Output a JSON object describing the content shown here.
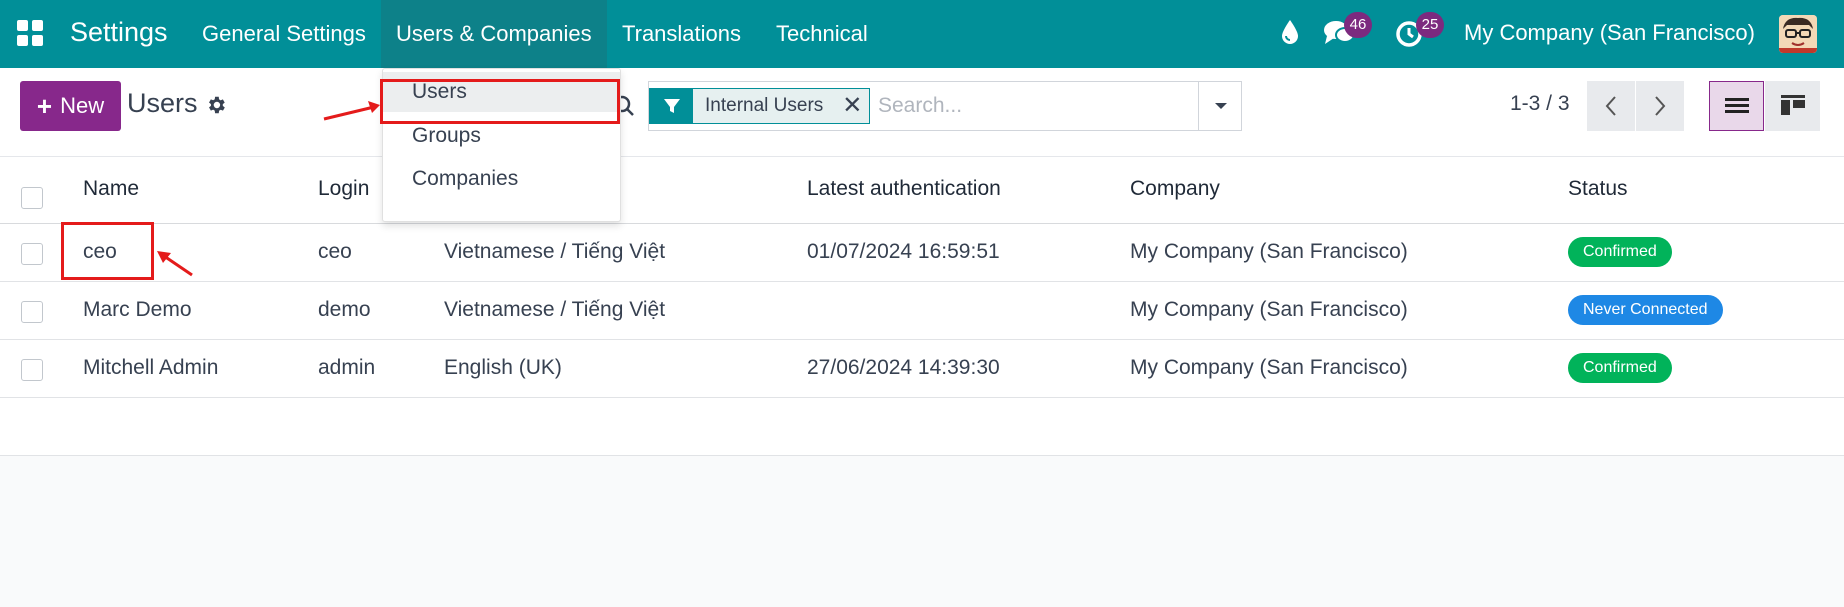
{
  "navbar": {
    "brand": "Settings",
    "menus": [
      "General Settings",
      "Users & Companies",
      "Translations",
      "Technical"
    ],
    "messages_badge": "46",
    "activities_badge": "25",
    "company": "My Company (San Francisco)",
    "color": "#018f98"
  },
  "control": {
    "new_label": "New",
    "title": "Users",
    "facet_label": "Internal Users",
    "search_placeholder": "Search...",
    "pager": "1-3 / 3"
  },
  "dropdown": {
    "items": [
      "Users",
      "Groups",
      "Companies"
    ]
  },
  "table": {
    "headers": [
      "Name",
      "Login",
      "Latest authentication",
      "Company",
      "Status"
    ],
    "rows": [
      {
        "name": "ceo",
        "login": "ceo",
        "language": "Vietnamese / Tiếng Việt",
        "latest_auth": "01/07/2024 16:59:51",
        "company": "My Company (San Francisco)",
        "status": "Confirmed"
      },
      {
        "name": "Marc Demo",
        "login": "demo",
        "language": "Vietnamese / Tiếng Việt",
        "latest_auth": "",
        "company": "My Company (San Francisco)",
        "status": "Never Connected"
      },
      {
        "name": "Mitchell Admin",
        "login": "admin",
        "language": "English (UK)",
        "latest_auth": "27/06/2024 14:39:30",
        "company": "My Company (San Francisco)",
        "status": "Confirmed"
      }
    ]
  },
  "colors": {
    "primary": "#87288b",
    "confirmed": "#01b35a",
    "never_connected": "#1e88e5",
    "annotation": "#e41b1b"
  }
}
